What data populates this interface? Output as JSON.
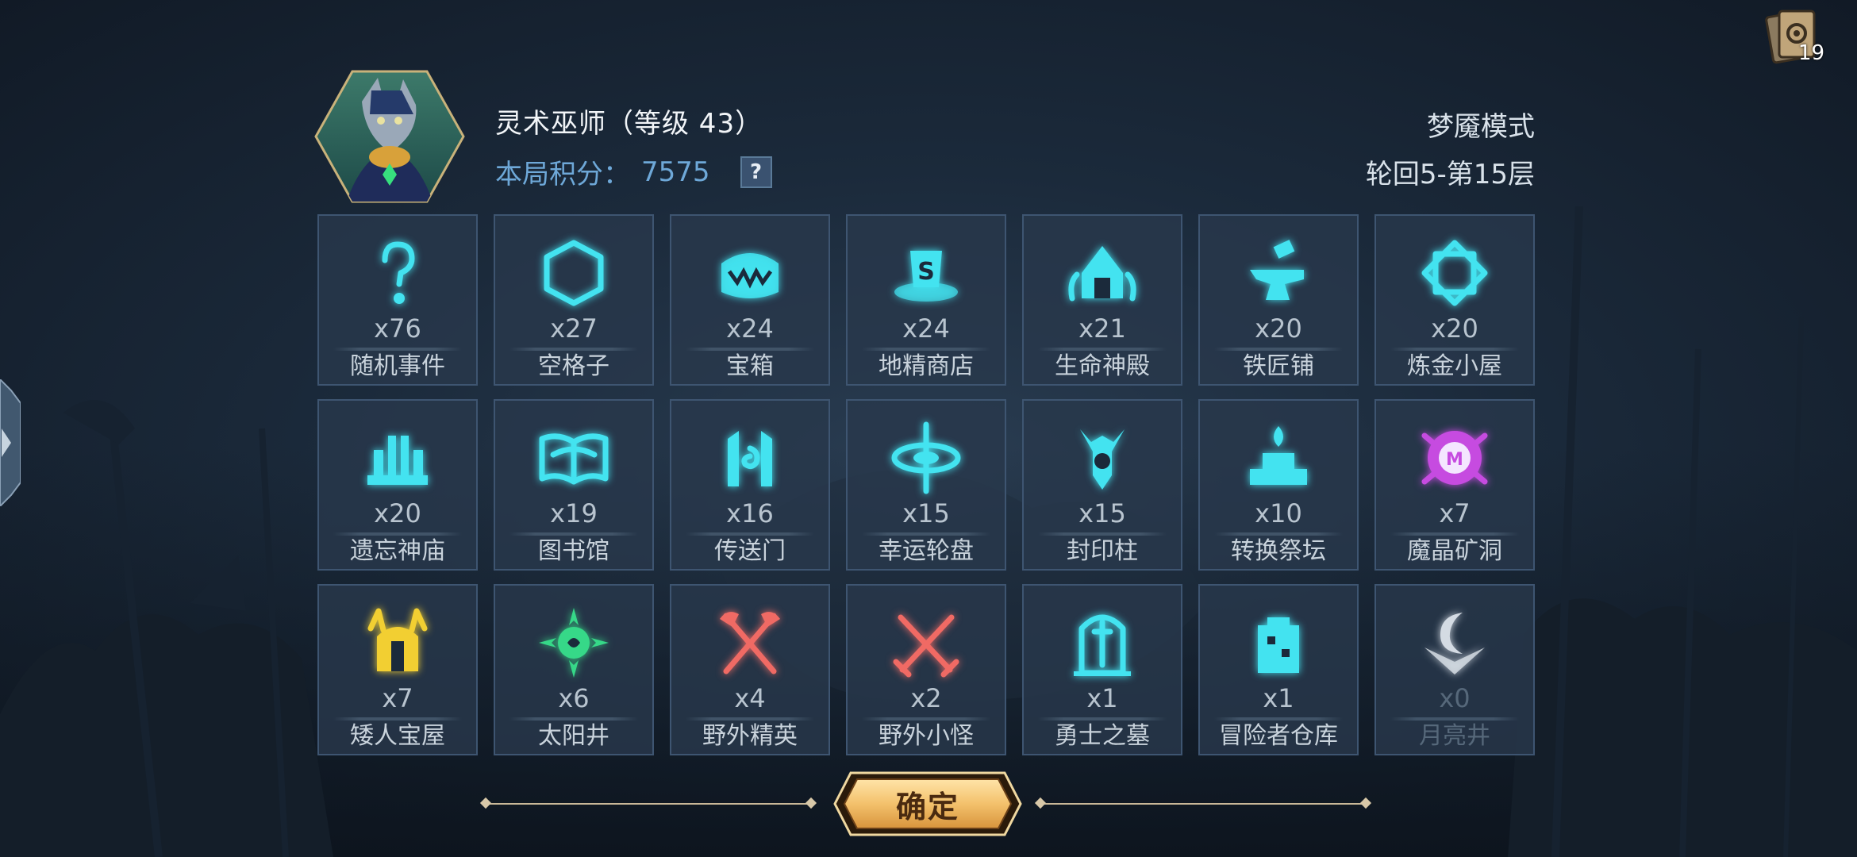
{
  "hero": {
    "name": "灵术巫师（等级 43）",
    "score_label": "本局积分：",
    "score_value": "7575",
    "help_icon": "?",
    "avatar_icon": "wolf-wizard-portrait-icon"
  },
  "run": {
    "mode": "梦魇模式",
    "progress": "轮回5-第15层"
  },
  "deck": {
    "count": "19",
    "icon": "card-deck-icon"
  },
  "tiles": [
    {
      "icon": "question-mark-icon",
      "count": "x76",
      "label": "随机事件",
      "color": "#43e3f0"
    },
    {
      "icon": "hexagon-icon",
      "count": "x27",
      "label": "空格子",
      "color": "#43e3f0"
    },
    {
      "icon": "treasure-chest-icon",
      "count": "x24",
      "label": "宝箱",
      "color": "#43e3f0"
    },
    {
      "icon": "goblin-shop-icon",
      "count": "x24",
      "label": "地精商店",
      "color": "#43e3f0"
    },
    {
      "icon": "life-temple-icon",
      "count": "x21",
      "label": "生命神殿",
      "color": "#43e3f0"
    },
    {
      "icon": "anvil-icon",
      "count": "x20",
      "label": "铁匠铺",
      "color": "#43e3f0"
    },
    {
      "icon": "alchemy-rune-icon",
      "count": "x20",
      "label": "炼金小屋",
      "color": "#43e3f0"
    },
    {
      "icon": "forgotten-temple-icon",
      "count": "x20",
      "label": "遗忘神庙",
      "color": "#43e3f0"
    },
    {
      "icon": "book-icon",
      "count": "x19",
      "label": "图书馆",
      "color": "#43e3f0"
    },
    {
      "icon": "portal-icon",
      "count": "x16",
      "label": "传送门",
      "color": "#43e3f0"
    },
    {
      "icon": "fortune-wheel-icon",
      "count": "x15",
      "label": "幸运轮盘",
      "color": "#43e3f0"
    },
    {
      "icon": "seal-pillar-icon",
      "count": "x15",
      "label": "封印柱",
      "color": "#43e3f0"
    },
    {
      "icon": "transform-altar-icon",
      "count": "x10",
      "label": "转换祭坛",
      "color": "#43e3f0"
    },
    {
      "icon": "magic-crystal-mine-icon",
      "count": "x7",
      "label": "魔晶矿洞",
      "color": "#c64be0"
    },
    {
      "icon": "dwarf-treasury-icon",
      "count": "x7",
      "label": "矮人宝屋",
      "color": "#f2cf32"
    },
    {
      "icon": "sun-well-icon",
      "count": "x6",
      "label": "太阳井",
      "color": "#36d888"
    },
    {
      "icon": "crossed-axes-icon",
      "count": "x4",
      "label": "野外精英",
      "color": "#f06a64"
    },
    {
      "icon": "crossed-swords-icon",
      "count": "x2",
      "label": "野外小怪",
      "color": "#f06a64"
    },
    {
      "icon": "tombstone-sword-icon",
      "count": "x1",
      "label": "勇士之墓",
      "color": "#43e3f0"
    },
    {
      "icon": "warehouse-tower-icon",
      "count": "x1",
      "label": "冒险者仓库",
      "color": "#43e3f0"
    },
    {
      "icon": "moon-well-icon",
      "count": "x0",
      "label": "月亮井",
      "color": "#e8eef5"
    }
  ],
  "confirm": {
    "label": "确定"
  }
}
